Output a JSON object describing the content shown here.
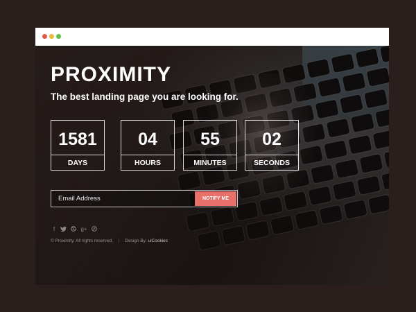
{
  "window": {
    "controls": [
      "close",
      "minimize",
      "maximize"
    ]
  },
  "hero": {
    "brand": "PROXIMITY",
    "tagline": "The best landing page you are looking for."
  },
  "countdown": [
    {
      "value": "1581",
      "label": "DAYS"
    },
    {
      "value": "04",
      "label": "HOURS"
    },
    {
      "value": "55",
      "label": "MINUTES"
    },
    {
      "value": "02",
      "label": "SECONDS"
    }
  ],
  "subscribe": {
    "placeholder": "Email Address",
    "button_label": "NOTIFY ME",
    "button_color": "#e8706a"
  },
  "socials": [
    "facebook-icon",
    "twitter-icon",
    "dribbble-icon",
    "google-plus-icon",
    "pinterest-icon"
  ],
  "footer": {
    "copyright": "© Proximity. All rights reserved.",
    "separator": "|",
    "design_label": "Design By:",
    "design_link": "uiCookies"
  }
}
